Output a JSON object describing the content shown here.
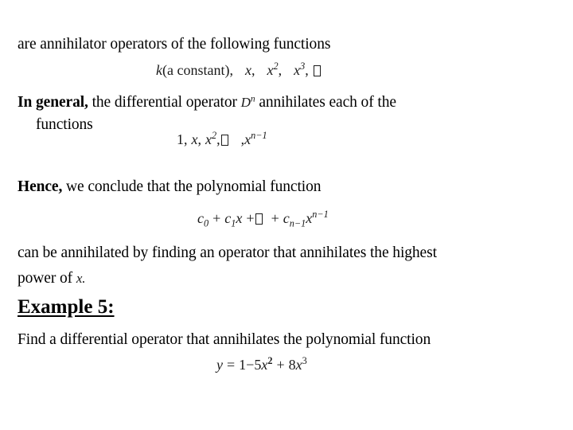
{
  "slide": {
    "background_color": "#ffffff",
    "text_color": "#000000",
    "lines": {
      "intro": "are annihilator operators of the following functions",
      "general_bold": "In general,",
      "general_rest_a": " the differential operator ",
      "general_rest_b": " annihilates each of the",
      "general_cont": "functions",
      "hence_bold": "Hence,",
      "hence_rest": " we conclude that the polynomial function",
      "can_be": "can be annihilated by finding an operator that annihilates the highest",
      "power_of": "power of ",
      "power_var": "x.",
      "example_heading": "Example 5:",
      "find_op": "Find a differential operator that annihilates the polynomial function"
    },
    "math": {
      "eq1": {
        "label": "k(a constant), x, x^2, x^3, ...",
        "k": "k",
        "a_constant": "(a constant),",
        "x1": "x",
        "comma1": ",",
        "x2": "x",
        "x2_exp": "2",
        "comma2": ",",
        "x3": "x",
        "x3_exp": "3",
        "comma3": ",",
        "ellipsis_glyph": "missing-glyph-box"
      },
      "eq2": {
        "label": "1, x, x^2, ... , x^(n-1)",
        "one": "1",
        "comma1": ",",
        "x1": "x",
        "comma2": ",",
        "x2": "x",
        "x2_exp": "2",
        "comma3": ",",
        "ellipsis_glyph": "missing-glyph-box",
        "comma4": ",",
        "xn": "x",
        "xn_exp": "n−1"
      },
      "eq3": {
        "label": "c_0 + c_1 x + ... + c_(n-1) x^(n-1)",
        "c": "c",
        "c_sub0": "0",
        "plus1": "+",
        "c1": "c",
        "c1_sub": "1",
        "x1": "x",
        "plus2": "+",
        "ellipsis_glyph": "missing-glyph-box",
        "plus3": "+",
        "cn": "c",
        "cn_sub": "n−1",
        "xn": "x",
        "xn_exp": "n−1"
      },
      "eq4": {
        "label": "y = 1 - 5x^2 + 8x^3",
        "y": "y",
        "equals": "=",
        "one": "1",
        "minus": "−",
        "five": "5",
        "x2": "x",
        "x2_exp": "2",
        "plus": "+",
        "eight": "8",
        "x3": "x",
        "x3_exp": "3"
      },
      "operator_d": {
        "d": "D",
        "exp": "n"
      }
    }
  }
}
